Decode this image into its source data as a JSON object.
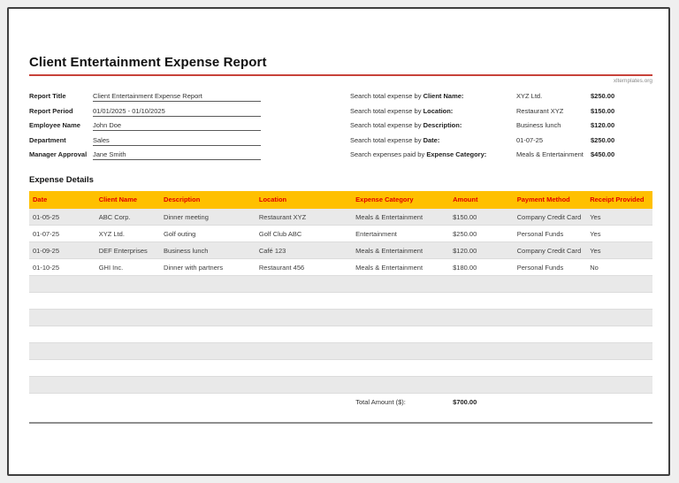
{
  "page": {
    "title": "Client Entertainment Expense Report",
    "watermark": "xltemplates.org"
  },
  "report_info": {
    "fields": [
      {
        "label": "Report Title",
        "value": "Client Entertainment Expense Report"
      },
      {
        "label": "Report Period",
        "value": "01/01/2025 - 01/10/2025"
      },
      {
        "label": "Employee Name",
        "value": "John Doe"
      },
      {
        "label": "Department",
        "value": "Sales"
      },
      {
        "label": "Manager Approval",
        "value": "Jane Smith"
      }
    ]
  },
  "search_summary": {
    "rows": [
      {
        "label_prefix": "Search total expense by ",
        "label_key": "Client Name:",
        "value": "XYZ Ltd.",
        "amount": "$250.00"
      },
      {
        "label_prefix": "Search total expense by ",
        "label_key": "Location:",
        "value": "Restaurant XYZ",
        "amount": "$150.00"
      },
      {
        "label_prefix": "Search total expense by ",
        "label_key": "Description:",
        "value": "Business lunch",
        "amount": "$120.00"
      },
      {
        "label_prefix": "Search total expense by ",
        "label_key": "Date:",
        "value": "01-07-25",
        "amount": "$250.00"
      },
      {
        "label_prefix": "Search expenses paid by ",
        "label_key": "Expense Category:",
        "value": "Meals & Entertainment",
        "amount": "$450.00"
      }
    ]
  },
  "expense_details": {
    "section_title": "Expense Details",
    "columns": [
      "Date",
      "Client Name",
      "Description",
      "Location",
      "Expense Category",
      "Amount",
      "Payment Method",
      "Receipt Provided"
    ],
    "rows": [
      [
        "01-05-25",
        "ABC Corp.",
        "Dinner meeting",
        "Restaurant XYZ",
        "Meals & Entertainment",
        "$150.00",
        "Company Credit Card",
        "Yes"
      ],
      [
        "01-07-25",
        "XYZ Ltd.",
        "Golf outing",
        "Golf Club ABC",
        "Entertainment",
        "$250.00",
        "Personal Funds",
        "Yes"
      ],
      [
        "01-09-25",
        "DEF Enterprises",
        "Business lunch",
        "Café 123",
        "Meals & Entertainment",
        "$120.00",
        "Company Credit Card",
        "Yes"
      ],
      [
        "01-10-25",
        "GHI Inc.",
        "Dinner with partners",
        "Restaurant 456",
        "Meals & Entertainment",
        "$180.00",
        "Personal Funds",
        "No"
      ]
    ],
    "empty_row_count": 7,
    "total_label": "Total Amount ($):",
    "total_value": "$700.00"
  },
  "colors": {
    "table_header_bg": "#FFC000",
    "table_header_text": "#E00000",
    "accent_line": "#C8423A",
    "row_alt_bg": "#E9E9E9"
  }
}
